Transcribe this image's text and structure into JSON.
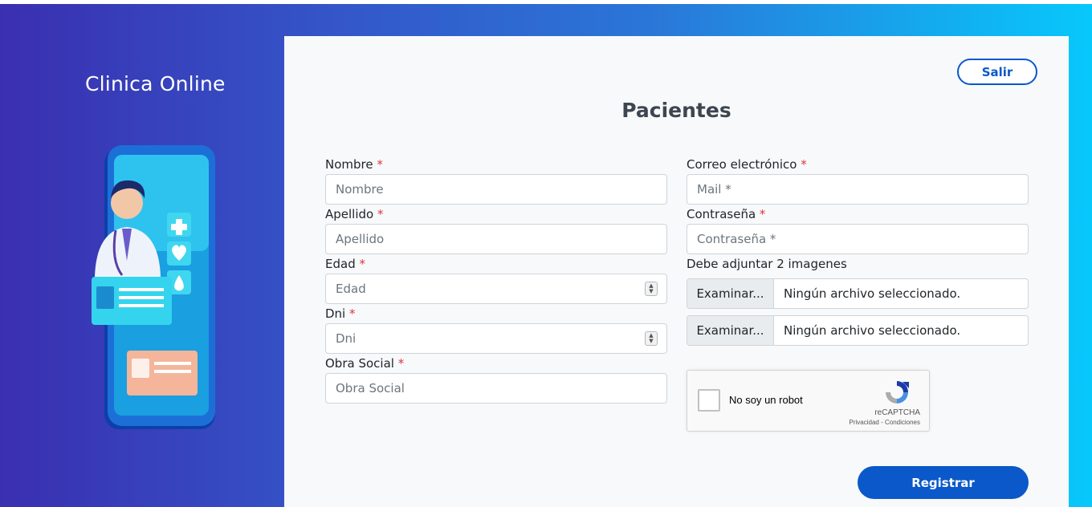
{
  "brand": {
    "title": "Clinica Online"
  },
  "header": {
    "logout_label": "Salir",
    "page_title": "Pacientes"
  },
  "form": {
    "nombre": {
      "label": "Nombre",
      "placeholder": "Nombre"
    },
    "apellido": {
      "label": "Apellido",
      "placeholder": "Apellido"
    },
    "edad": {
      "label": "Edad",
      "placeholder": "Edad"
    },
    "dni": {
      "label": "Dni",
      "placeholder": "Dni"
    },
    "obra_social": {
      "label": "Obra Social",
      "placeholder": "Obra Social"
    },
    "correo": {
      "label": "Correo electrónico",
      "placeholder": "Mail *"
    },
    "contrasena": {
      "label": "Contraseña",
      "placeholder": "Contraseña *"
    },
    "required_mark": "*",
    "images_note": "Debe adjuntar 2 imagenes",
    "file1": {
      "button": "Examinar...",
      "status": "Ningún archivo seleccionado."
    },
    "file2": {
      "button": "Examinar...",
      "status": "Ningún archivo seleccionado."
    },
    "captcha": {
      "label": "No soy un robot",
      "brand": "reCAPTCHA",
      "links": "Privacidad - Condiciones"
    },
    "submit_label": "Registrar"
  },
  "colors": {
    "accent": "#0a58ca",
    "required": "#dc3545",
    "gradient_start": "#3a2fb0",
    "gradient_end": "#07c8fb"
  }
}
